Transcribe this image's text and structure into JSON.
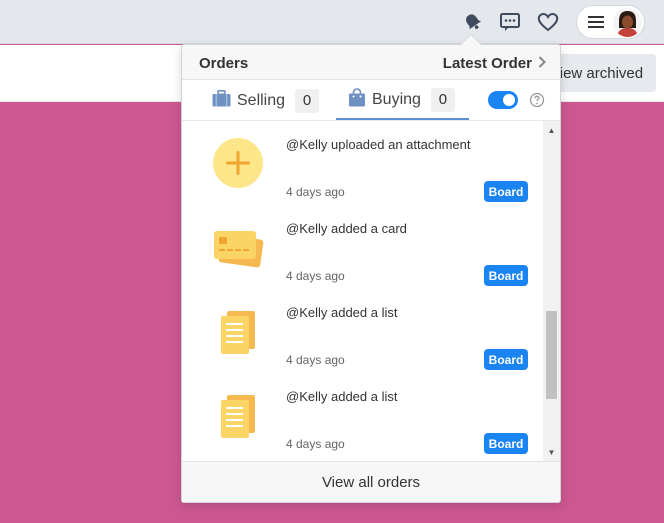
{
  "header": {
    "icons": [
      "bell-icon",
      "chat-icon",
      "heart-icon",
      "menu-icon"
    ],
    "view_archived_label": "View archived"
  },
  "orders": {
    "title": "Orders",
    "latest_order_label": "Latest Order",
    "tabs": [
      {
        "label": "Selling",
        "count": "0",
        "icon": "briefcase-icon"
      },
      {
        "label": "Buying",
        "count": "0",
        "icon": "shopping-bag-icon"
      }
    ],
    "toggle_on": true,
    "items": [
      {
        "text": "@Kelly uploaded an attachment",
        "time": "4 days ago",
        "button": "Board",
        "icon": "plus-circle-icon"
      },
      {
        "text": "@Kelly added a card",
        "time": "4 days ago",
        "button": "Board",
        "icon": "credit-card-icon"
      },
      {
        "text": "@Kelly added a list",
        "time": "4 days ago",
        "button": "Board",
        "icon": "document-list-icon"
      },
      {
        "text": "@Kelly added a list",
        "time": "4 days ago",
        "button": "Board",
        "icon": "document-list-icon"
      }
    ],
    "footer_label": "View all orders"
  },
  "colors": {
    "accent": "#1a84f2",
    "background": "#cd5891",
    "icon_yellow": "#fad465"
  }
}
